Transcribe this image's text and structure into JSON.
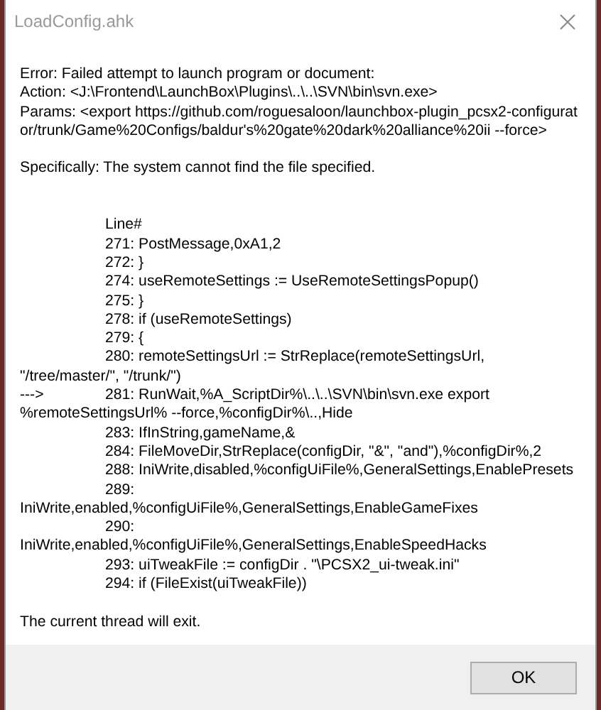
{
  "window": {
    "title": "LoadConfig.ahk"
  },
  "message": {
    "error_lines": [
      "Error:  Failed attempt to launch program or document:",
      "Action: <J:\\Frontend\\LaunchBox\\Plugins\\..\\..\\SVN\\bin\\svn.exe>",
      "Params: <export https://github.com/roguesaloon/launchbox-plugin_pcsx2-configurator/trunk/Game%20Configs/baldur's%20gate%20dark%20alliance%20ii --force>"
    ],
    "specifically": "Specifically: The system cannot find the file specified.",
    "listing_header": "Line#",
    "listing": [
      {
        "text": "271: PostMessage,0xA1,2"
      },
      {
        "text": "272: }"
      },
      {
        "text": "274: useRemoteSettings := UseRemoteSettingsPopup()"
      },
      {
        "text": "275: }"
      },
      {
        "text": "278: if (useRemoteSettings)"
      },
      {
        "text": "279: {"
      },
      {
        "text": "280: remoteSettingsUrl := StrReplace(remoteSettingsUrl, \"/tree/master/\", \"/trunk/\")"
      },
      {
        "marker": "--->",
        "text": "281: RunWait,%A_ScriptDir%\\..\\..\\SVN\\bin\\svn.exe export",
        "continuation": "%remoteSettingsUrl% --force,%configDir%\\..,Hide"
      },
      {
        "text": "283: IfInString,gameName,&"
      },
      {
        "text": "284: FileMoveDir,StrReplace(configDir, \"&\", \"and\"),%configDir%,2"
      },
      {
        "text": "288: IniWrite,disabled,%configUiFile%,GeneralSettings,EnablePresets"
      },
      {
        "text": "289: IniWrite,enabled,%configUiFile%,GeneralSettings,EnableGameFixes"
      },
      {
        "text": "290: IniWrite,enabled,%configUiFile%,GeneralSettings,EnableSpeedHacks"
      },
      {
        "text": "293: uiTweakFile := configDir . \"\\PCSX2_ui-tweak.ini\""
      },
      {
        "text": "294: if (FileExist(uiTweakFile))"
      }
    ],
    "footer_text": "The current thread will exit."
  },
  "buttons": [
    "OK"
  ]
}
